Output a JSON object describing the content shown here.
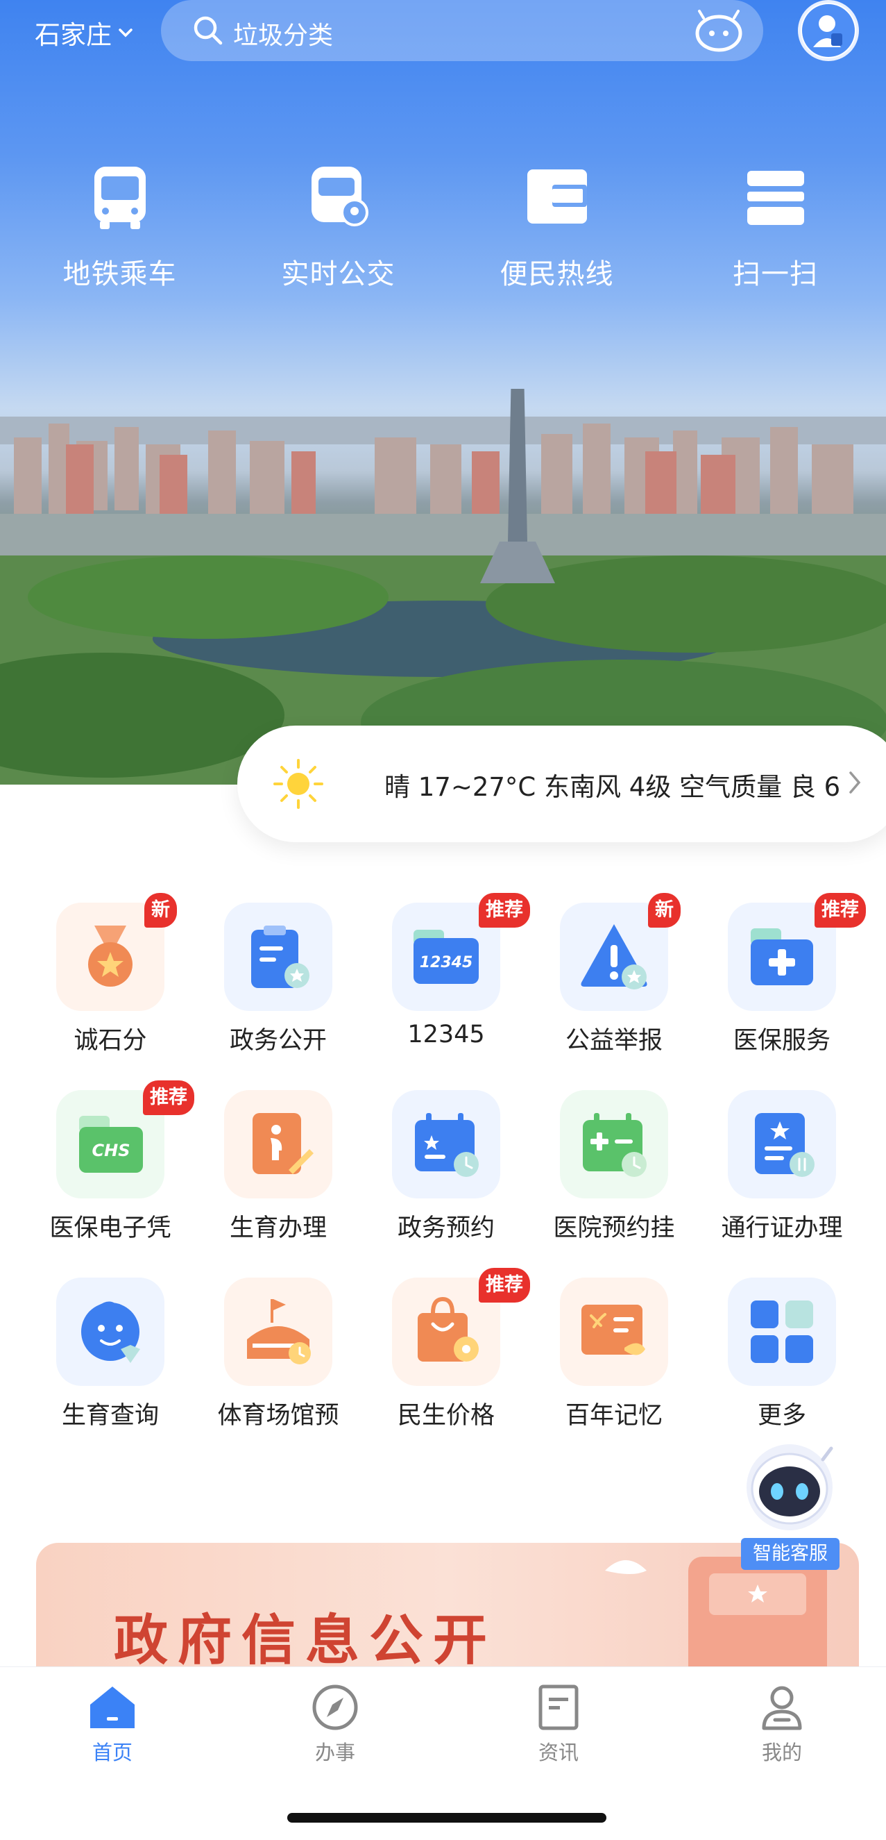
{
  "header": {
    "city": "石家庄",
    "search_placeholder": "垃圾分类"
  },
  "quick_actions": [
    {
      "label": "地铁乘车",
      "icon": "bus-icon"
    },
    {
      "label": "实时公交",
      "icon": "bus-location-icon"
    },
    {
      "label": "便民热线",
      "icon": "wallet-icon"
    },
    {
      "label": "扫一扫",
      "icon": "scan-icon"
    }
  ],
  "weather": {
    "text": "晴 17~27°C 东南风 4级 空气质量 良 6"
  },
  "services": [
    {
      "label": "诚石分",
      "badge": "新",
      "icon": "medal-icon"
    },
    {
      "label": "政务公开",
      "badge": "",
      "icon": "clipboard-icon"
    },
    {
      "label": "12345",
      "badge": "推荐",
      "icon": "hotline-card-icon"
    },
    {
      "label": "公益举报",
      "badge": "新",
      "icon": "warning-icon"
    },
    {
      "label": "医保服务",
      "badge": "推荐",
      "icon": "medical-folder-icon"
    },
    {
      "label": "医保电子凭",
      "badge": "推荐",
      "icon": "chs-card-icon"
    },
    {
      "label": "生育办理",
      "badge": "",
      "icon": "pregnancy-doc-icon"
    },
    {
      "label": "政务预约",
      "badge": "",
      "icon": "calendar-icon"
    },
    {
      "label": "医院预约挂",
      "badge": "",
      "icon": "hospital-calendar-icon"
    },
    {
      "label": "通行证办理",
      "badge": "",
      "icon": "pass-doc-icon"
    },
    {
      "label": "生育查询",
      "badge": "",
      "icon": "baby-icon"
    },
    {
      "label": "体育场馆预",
      "badge": "",
      "icon": "stadium-icon"
    },
    {
      "label": "民生价格",
      "badge": "推荐",
      "icon": "shopping-bag-icon"
    },
    {
      "label": "百年记忆",
      "badge": "",
      "icon": "party-book-icon"
    },
    {
      "label": "更多",
      "badge": "",
      "icon": "grid-more-icon"
    }
  ],
  "banner": {
    "title": "政府信息公开"
  },
  "assistant": {
    "label": "智能客服"
  },
  "tabs": [
    {
      "label": "首页",
      "active": true
    },
    {
      "label": "办事",
      "active": false
    },
    {
      "label": "资讯",
      "active": false
    },
    {
      "label": "我的",
      "active": false
    }
  ],
  "colors": {
    "accent": "#3b82f6",
    "badge": "#e8312c",
    "banner_text": "#cf4432"
  }
}
